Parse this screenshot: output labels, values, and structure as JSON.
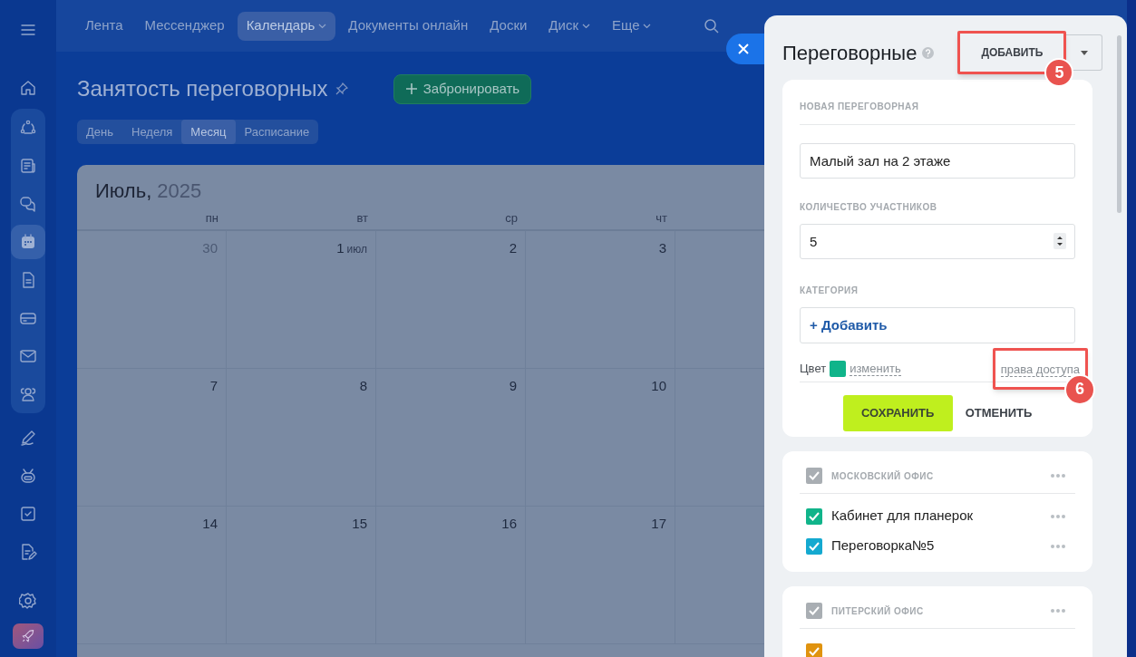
{
  "sidebar": {
    "items": [
      {
        "selected": false
      },
      {
        "selected": false
      },
      {
        "selected": false
      },
      {
        "selected": false
      },
      {
        "selected": false
      },
      {
        "selected": true
      },
      {
        "selected": false
      },
      {
        "selected": false
      },
      {
        "selected": false
      },
      {
        "selected": false
      },
      {
        "selected": false
      },
      {
        "selected": false
      },
      {
        "selected": false
      },
      {
        "selected": false
      }
    ]
  },
  "top_nav": {
    "items": [
      {
        "label": "Лента",
        "selected": false,
        "dropdown": false
      },
      {
        "label": "Мессенджер",
        "selected": false,
        "dropdown": false
      },
      {
        "label": "Календарь",
        "selected": true,
        "dropdown": true
      },
      {
        "label": "Документы онлайн",
        "selected": false,
        "dropdown": false
      },
      {
        "label": "Доски",
        "selected": false,
        "dropdown": false
      },
      {
        "label": "Диск",
        "selected": false,
        "dropdown": true
      },
      {
        "label": "Еще",
        "selected": false,
        "dropdown": true
      }
    ]
  },
  "page": {
    "title": "Занятость переговорных",
    "book_button": "Забронировать",
    "view_tabs": [
      {
        "label": "День",
        "selected": false
      },
      {
        "label": "Неделя",
        "selected": false
      },
      {
        "label": "Месяц",
        "selected": true
      },
      {
        "label": "Расписание",
        "selected": false
      }
    ]
  },
  "calendar": {
    "month": "Июль,",
    "year": "2025",
    "weekdays": [
      "пн",
      "вт",
      "ср",
      "чт"
    ],
    "weeks": [
      [
        {
          "day": "30",
          "other_month": true
        },
        {
          "day": "1",
          "month_label": "июл",
          "other_month": false
        },
        {
          "day": "2",
          "other_month": false
        },
        {
          "day": "3",
          "other_month": false
        }
      ],
      [
        {
          "day": "7",
          "other_month": false
        },
        {
          "day": "8",
          "other_month": false
        },
        {
          "day": "9",
          "other_month": false
        },
        {
          "day": "10",
          "other_month": false
        }
      ],
      [
        {
          "day": "14",
          "other_month": false
        },
        {
          "day": "15",
          "other_month": false
        },
        {
          "day": "16",
          "other_month": false
        },
        {
          "day": "17",
          "other_month": false
        }
      ]
    ]
  },
  "panel": {
    "title": "Переговорные",
    "add_button": "ДОБАВИТЬ",
    "form": {
      "section_title": "НОВАЯ ПЕРЕГОВОРНАЯ",
      "name_value": "Малый зал на 2 этаже",
      "participants_label": "КОЛИЧЕСТВО УЧАСТНИКОВ",
      "participants_value": "5",
      "category_label": "КАТЕГОРИЯ",
      "category_add": "+ Добавить",
      "color_label": "Цвет",
      "color": "#10b48a",
      "color_change": "изменить",
      "access_link": "права доступа",
      "save_button": "СОХРАНИТЬ",
      "cancel_button": "ОТМЕНИТЬ"
    },
    "groups": [
      {
        "title": "МОСКОВСКИЙ ОФИС",
        "checked": true,
        "items": [
          {
            "label": "Кабинет для планерок",
            "color": "#10b48a",
            "checked": true
          },
          {
            "label": "Переговорка№5",
            "color": "#14a9d0",
            "checked": true
          }
        ]
      },
      {
        "title": "ПИТЕРСКИЙ ОФИС",
        "checked": true,
        "items": [
          {
            "color": "#e0930f",
            "checked": true
          }
        ]
      }
    ]
  },
  "annotations": [
    {
      "label": "5"
    },
    {
      "label": "6"
    }
  ]
}
